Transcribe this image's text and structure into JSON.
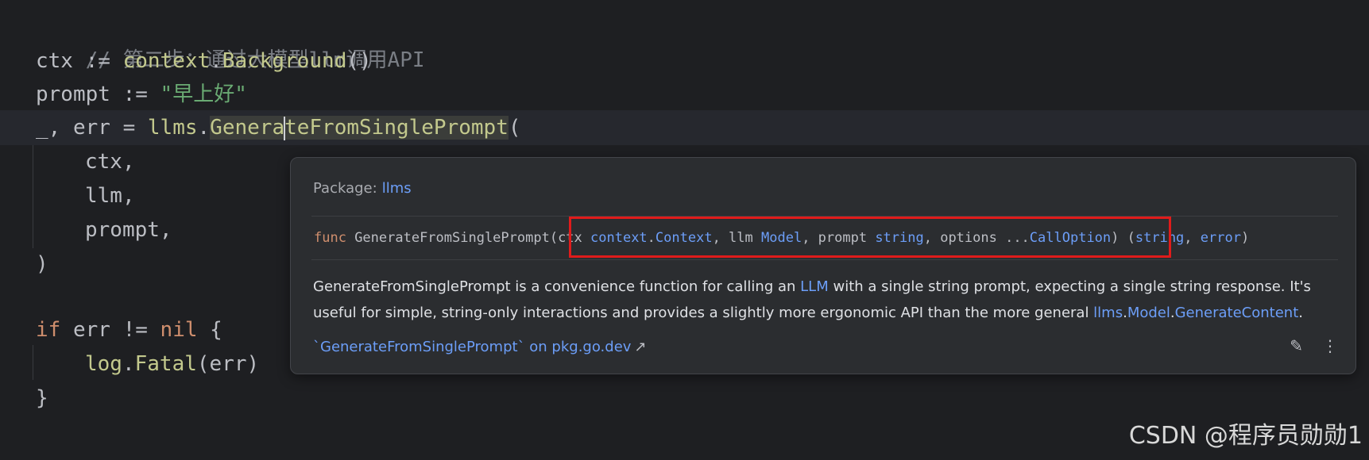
{
  "code": {
    "line1": "// 第二步：通过大模型llm调用API",
    "line2": {
      "var": "ctx := ",
      "pkg": "context",
      "dot": ".",
      "fn": "Background",
      "rest": "()"
    },
    "line3": {
      "var": "prompt := ",
      "str": "\"早上好\""
    },
    "line4": {
      "prefix": "_, err = ",
      "pkg": "llms",
      "dot": ".",
      "fn_before_caret": "Genera",
      "fn_after_caret": "teFromSinglePrompt",
      "rest": "("
    },
    "line5": "ctx,",
    "line6": "llm,",
    "line7": "prompt,",
    "line8": ")",
    "line10": {
      "kw": "if",
      "mid": " err != ",
      "nil": "nil",
      "end": " {"
    },
    "line11": {
      "pkg": "log",
      "dot": ".",
      "fn": "Fatal",
      "rest": "(err)"
    },
    "line12": "}"
  },
  "popup": {
    "package_label": "Package:",
    "package_name": "llms",
    "signature": {
      "kw": "func",
      "name": " GenerateFromSinglePrompt",
      "p1": "(ctx ",
      "t1a": "context",
      "t1dot": ".",
      "t1b": "Context",
      "p2": ", llm ",
      "t2": "Model",
      "p3": ", prompt ",
      "t3": "string",
      "p4": ", options ...",
      "t4": "CallOption",
      "p5": ") (",
      "t5": "string",
      "p6": ", ",
      "t6": "error",
      "p7": ")"
    },
    "description": {
      "part1": "GenerateFromSinglePrompt is a convenience function for calling an ",
      "link1": "LLM",
      "part2": " with a single string prompt, expecting a single string response. It's useful for simple, string-only interactions and provides a slightly more ergonomic API than the more general ",
      "link2a": "llms",
      "link2dot": ".",
      "link2b": "Model",
      "link2dot2": ".",
      "link2c": "GenerateContent",
      "part3": "."
    },
    "external_link": "`GenerateFromSinglePrompt` on pkg.go.dev",
    "external_arrow": "↗",
    "edit_icon": "✎",
    "more_icon": "⋮"
  },
  "watermark": "CSDN @程序员勋勋1",
  "colors": {
    "background": "#1e1f22",
    "popup_background": "#2b2d30",
    "link": "#6c9ef8",
    "keyword": "#cf8e6d",
    "string": "#6aab73",
    "function": "#c3c98d",
    "highlight_box": "#e01b1b"
  }
}
